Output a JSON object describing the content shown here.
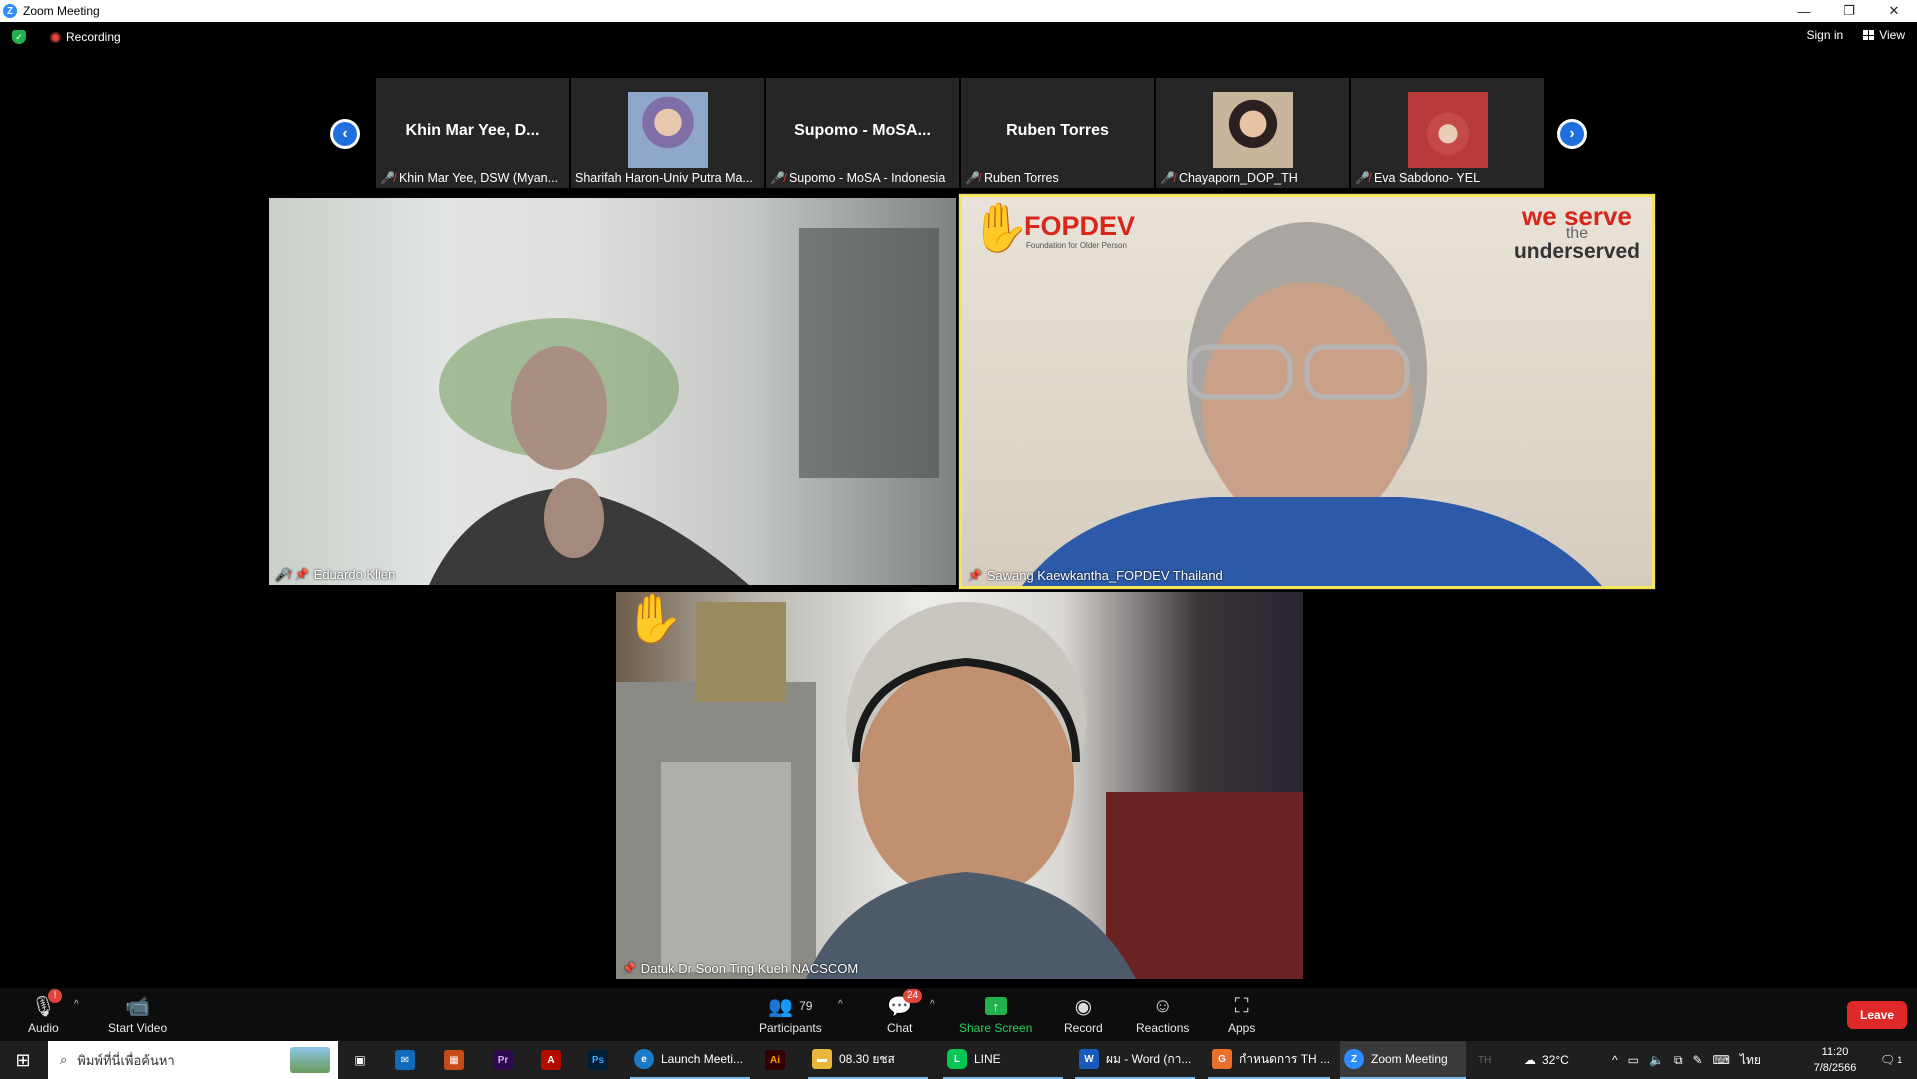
{
  "window": {
    "title": "Zoom Meeting",
    "min": "—",
    "max": "❐",
    "close": "✕"
  },
  "topbar": {
    "recording_label": "Recording",
    "sign_in": "Sign in",
    "view": "View"
  },
  "gallery_strip": [
    {
      "big_name": "Khin Mar Yee, D...",
      "caption": "Khin Mar Yee, DSW (Myan...",
      "muted": true,
      "photo": false
    },
    {
      "big_name": "",
      "caption": "Sharifah Haron-Univ Putra Ma...",
      "muted": false,
      "photo": true,
      "photo_color": "#8fa7c8"
    },
    {
      "big_name": "Supomo  -  MoSA...",
      "caption": "Supomo - MoSA - Indonesia",
      "muted": true,
      "photo": false
    },
    {
      "big_name": "Ruben Torres",
      "caption": "Ruben Torres",
      "muted": true,
      "photo": false
    },
    {
      "big_name": "",
      "caption": "Chayaporn_DOP_TH",
      "muted": true,
      "photo": true,
      "photo_color": "#c9b59c"
    },
    {
      "big_name": "",
      "caption": "Eva Sabdono- YEL",
      "muted": true,
      "photo": true,
      "photo_color": "#b83a3a"
    }
  ],
  "videos": {
    "v1": {
      "caption": "Eduardo Klien"
    },
    "v2": {
      "caption": "Sawang Kaewkantha_FOPDEV Thailand",
      "logo": "FOPDEV",
      "logo_sub": "Foundation for Older Person",
      "slogan1": "we serve",
      "slogan2": "the",
      "slogan3": "underserved"
    },
    "v3": {
      "caption": "Datuk Dr Soon Ting Kueh NACSCOM"
    }
  },
  "toolbar": {
    "audio": "Audio",
    "start_video": "Start Video",
    "participants": "Participants",
    "participants_count": "79",
    "chat": "Chat",
    "chat_badge": "24",
    "share_screen": "Share Screen",
    "record": "Record",
    "reactions": "Reactions",
    "apps": "Apps",
    "leave": "Leave",
    "audio_badge": "!"
  },
  "taskbar": {
    "search_placeholder": "พิมพ์ที่นี่เพื่อค้นหา",
    "items": {
      "edge": "Launch Meeti...",
      "folder": "08.30 ยชส",
      "line": "LINE",
      "word": "ผม - Word (กา...",
      "app": "กำหนดการ TH ...",
      "zoom": "Zoom Meeting"
    },
    "lang_hint": "TH",
    "temp": "32°C",
    "lang": "ไทย",
    "time": "11:20",
    "date": "7/8/2566",
    "notif": "1"
  }
}
